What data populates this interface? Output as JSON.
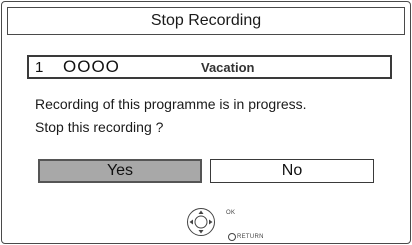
{
  "dialog": {
    "title": "Stop Recording",
    "programme": {
      "number": "1",
      "time": "OOOO",
      "title": "Vacation"
    },
    "message_line1": "Recording of this programme is in progress.",
    "message_line2": "Stop this recording ?",
    "buttons": {
      "yes": "Yes",
      "no": "No"
    },
    "hint": {
      "ok": "OK",
      "return": "RETURN"
    }
  },
  "colors": {
    "selected_button": "#a8a8a8",
    "border": "#4a4a4a"
  }
}
